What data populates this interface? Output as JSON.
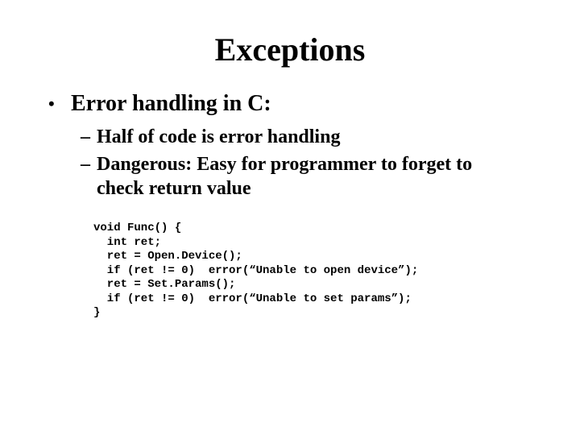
{
  "title": "Exceptions",
  "l1": "Error handling in C:",
  "l2a": "Half of code is error handling",
  "l2b": "Dangerous:  Easy for programmer to forget to check return value",
  "code": "void Func() {\n  int ret;\n  ret = Open.Device();\n  if (ret != 0)  error(“Unable to open device”);\n  ret = Set.Params();\n  if (ret != 0)  error(“Unable to set params”);\n}"
}
